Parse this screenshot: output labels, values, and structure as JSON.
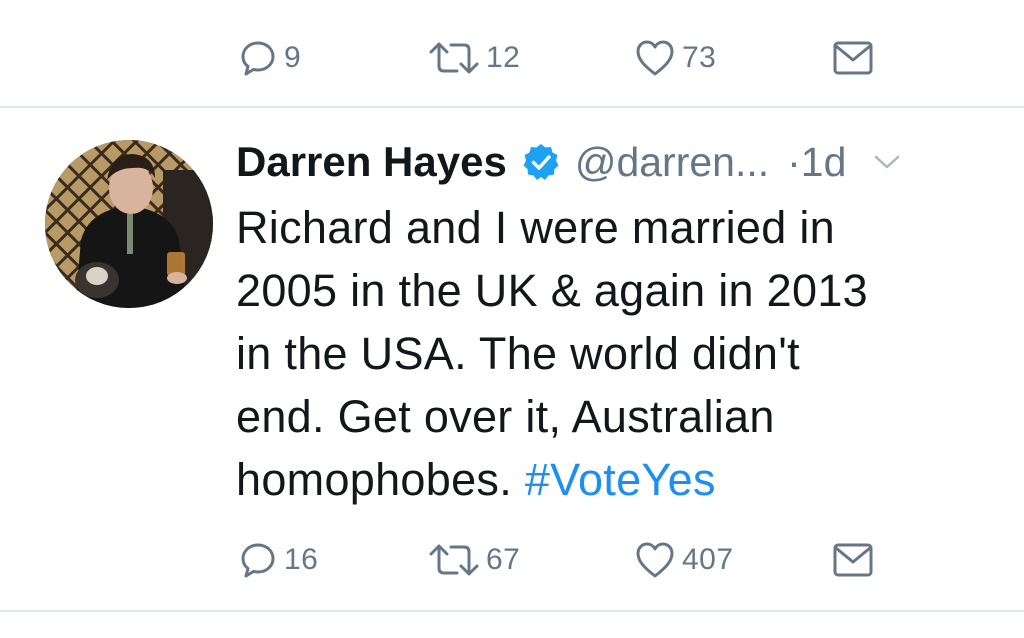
{
  "previous_tweet": {
    "reply_count": "9",
    "retweet_count": "12",
    "like_count": "73"
  },
  "tweet": {
    "author_name": "Darren Hayes",
    "handle": "@darren...",
    "separator": "·",
    "timestamp": "1d",
    "text_lines": [
      "Richard and I were married in",
      "2005 in the UK & again in 2013",
      "in the USA. The world didn't",
      "end. Get over it, Australian",
      "homophobes. "
    ],
    "hashtag": "#VoteYes",
    "reply_count": "16",
    "retweet_count": "67",
    "like_count": "407"
  },
  "icons": {
    "reply": "reply-icon",
    "retweet": "retweet-icon",
    "like": "heart-icon",
    "dm": "envelope-icon",
    "verified": "verified-badge-icon",
    "more": "chevron-down-icon"
  },
  "colors": {
    "text": "#14171a",
    "muted": "#657786",
    "link": "#1d8ef2",
    "verified": "#1da1f2",
    "divider": "#e1e8ed"
  }
}
